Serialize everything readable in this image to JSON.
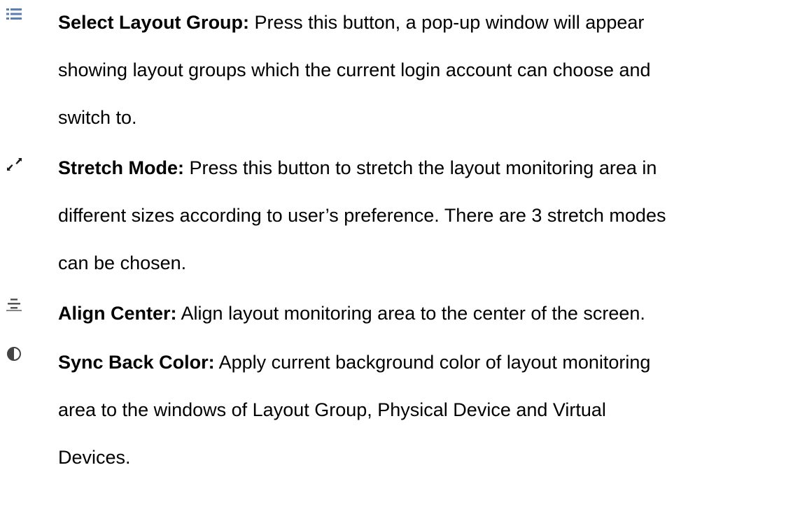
{
  "items": [
    {
      "icon": "list-icon",
      "term": "Select Layout Group:",
      "lines": [
        " Press this button, a pop-up window will appear",
        "showing layout groups which the current login account can choose and",
        "switch to."
      ]
    },
    {
      "icon": "expand-arrows-icon",
      "term": "Stretch Mode:",
      "lines": [
        " Press this button to stretch the layout monitoring area in",
        "different sizes according to user’s preference. There are 3 stretch modes",
        "can be chosen."
      ]
    },
    {
      "icon": "align-center-icon",
      "term": "Align Center:",
      "lines": [
        " Align layout monitoring area to the center of the screen."
      ]
    },
    {
      "icon": "contrast-icon",
      "term": "Sync Back Color:",
      "lines": [
        " Apply current background color of layout monitoring",
        "area to the windows of Layout Group, Physical Device and Virtual",
        "Devices."
      ]
    }
  ]
}
